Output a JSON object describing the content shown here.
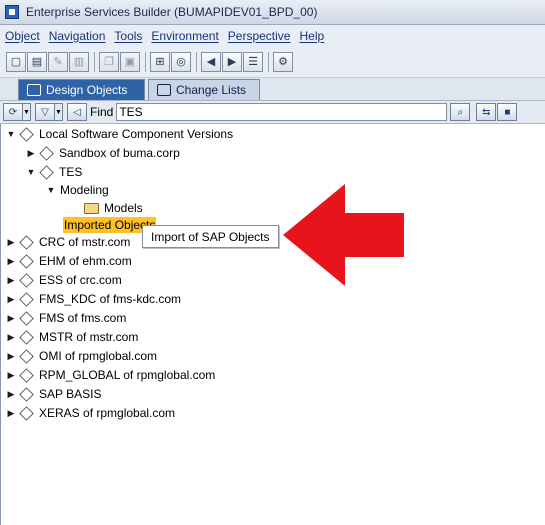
{
  "window": {
    "title": "Enterprise Services Builder (BUMAPIDEV01_BPD_00)"
  },
  "menu": [
    "Object",
    "Navigation",
    "Tools",
    "Environment",
    "Perspective",
    "Help"
  ],
  "tabs": {
    "design": "Design Objects",
    "changes": "Change Lists"
  },
  "search": {
    "find_label": "Find",
    "value": "TES"
  },
  "tree": {
    "root": "Local Software Component Versions",
    "sandbox": "Sandbox of buma.corp",
    "tes": "TES",
    "modeling": "Modeling",
    "models": "Models",
    "imported": "Imported Objects",
    "items": [
      "CRC of mstr.com",
      "EHM of ehm.com",
      "ESS of crc.com",
      "FMS_KDC of fms-kdc.com",
      "FMS of fms.com",
      "MSTR of mstr.com",
      "OMI of rpmglobal.com",
      "RPM_GLOBAL of rpmglobal.com",
      "SAP BASIS",
      "XERAS of rpmglobal.com"
    ]
  },
  "context_menu": {
    "item": "Import of SAP Objects"
  },
  "colors": {
    "annotation_arrow": "#e8141c",
    "highlight": "#ffc125",
    "active_tab": "#2f63a8"
  }
}
